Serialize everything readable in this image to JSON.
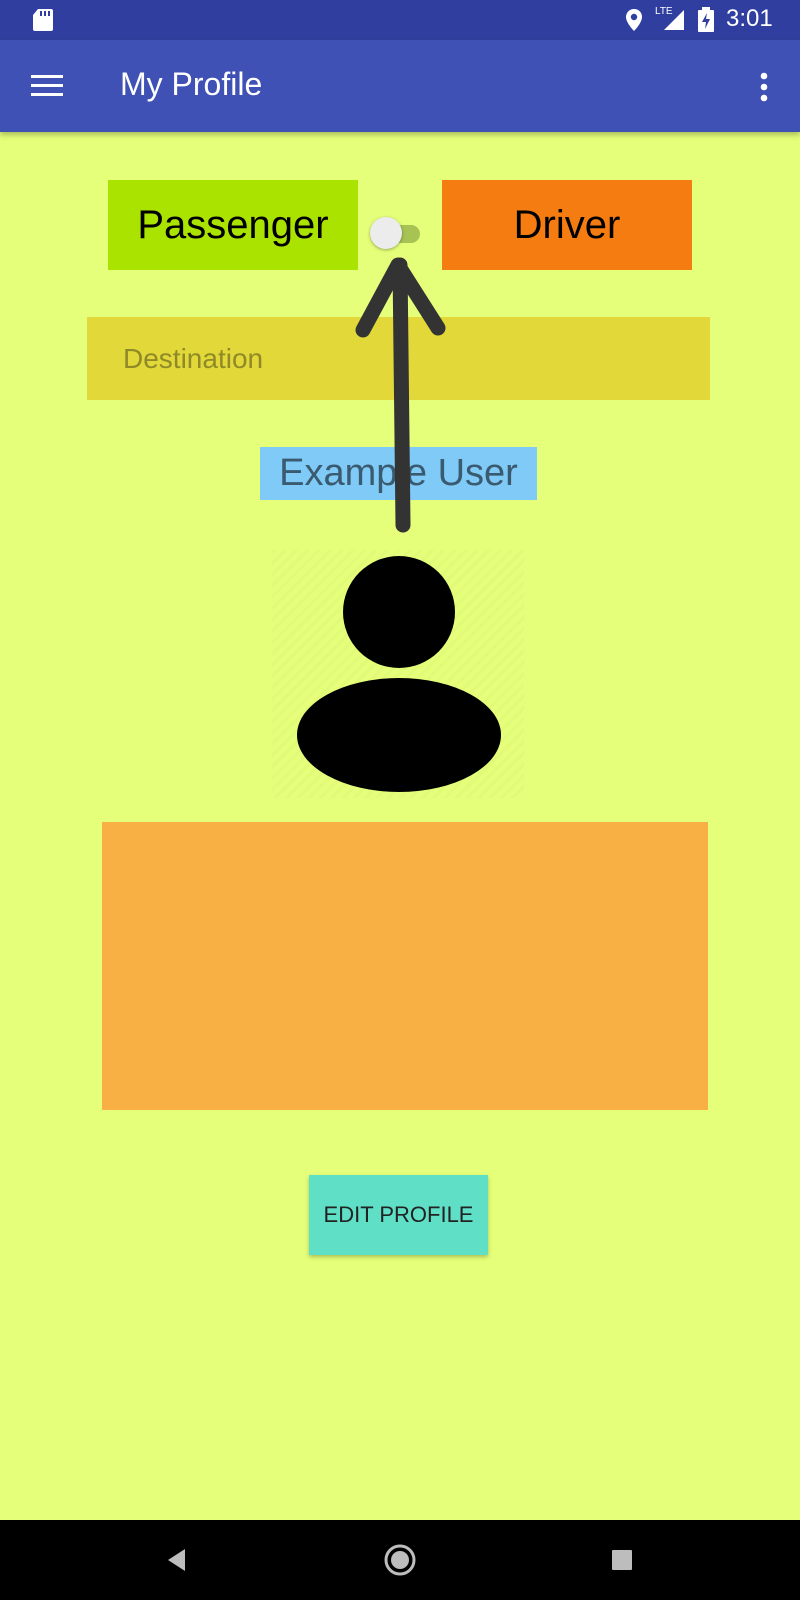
{
  "status_bar": {
    "time": "3:01",
    "network_label": "LTE",
    "icons": [
      "sd-card-icon",
      "location-icon",
      "signal-icon",
      "battery-charging-icon"
    ]
  },
  "app_bar": {
    "title": "My Profile",
    "menu_icon": "hamburger-menu-icon",
    "overflow_icon": "more-vert-icon"
  },
  "mode_switch": {
    "passenger_label": "Passenger",
    "driver_label": "Driver",
    "toggle_state": "off"
  },
  "destination": {
    "placeholder": "Destination",
    "value": ""
  },
  "profile": {
    "name": "Example User",
    "avatar_icon": "person-icon",
    "bio": ""
  },
  "actions": {
    "edit_profile_label": "EDIT PROFILE"
  },
  "nav_bar": {
    "icons": [
      "back-icon",
      "home-icon",
      "recents-icon"
    ]
  },
  "colors": {
    "status_bar": "#303f9f",
    "app_bar": "#3f51b5",
    "background": "#e5ff7a",
    "passenger": "#aae300",
    "driver": "#f57c10",
    "destination": "#e2d83a",
    "username_bg": "#7fcaf7",
    "bio_box": "#f8af43",
    "edit_button": "#5fdfc6",
    "annotation_arrow": "#333333"
  }
}
